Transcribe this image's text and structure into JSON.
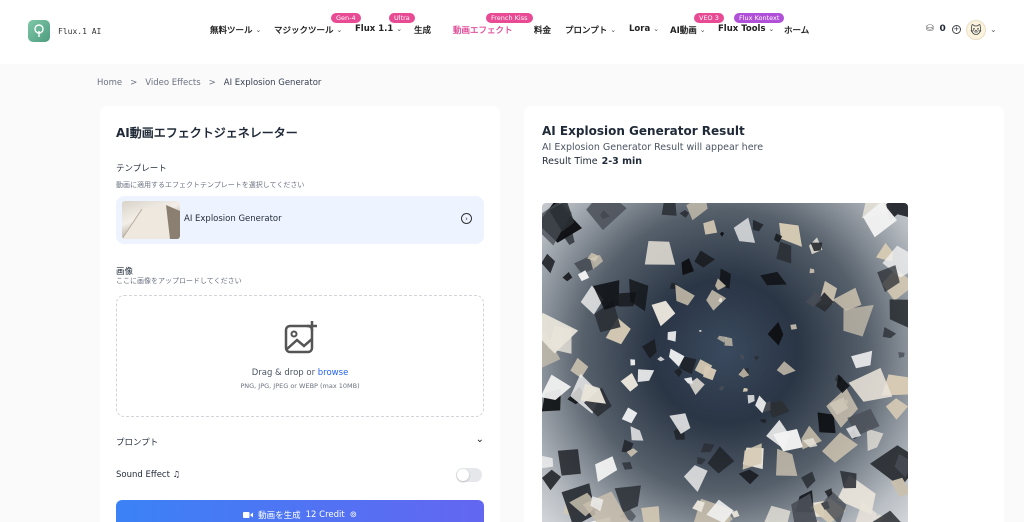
{
  "header": {
    "logo_text": "Flux.1 AI",
    "nav": [
      {
        "label": "無料ツール",
        "chev": "⌄",
        "badge": ""
      },
      {
        "label": "マジックツール",
        "chev": "⌄",
        "badge": "Gen-4"
      },
      {
        "label": "Flux 1.1",
        "chev": "⌄",
        "badge": "Ultra"
      },
      {
        "label": "生成",
        "chev": "",
        "badge": ""
      },
      {
        "label": "動画エフェクト",
        "chev": "",
        "badge": "French Kiss"
      },
      {
        "label": "料金",
        "chev": "",
        "badge": ""
      },
      {
        "label": "プロンプト",
        "chev": "⌄",
        "badge": ""
      },
      {
        "label": "Lora",
        "chev": "⌄",
        "badge": ""
      },
      {
        "label": "AI動画",
        "chev": "⌄",
        "badge": "VEO 3"
      },
      {
        "label": "Flux Tools",
        "chev": "⌄",
        "badge": "Flux Kontext"
      },
      {
        "label": "ホーム",
        "chev": "",
        "badge": ""
      }
    ],
    "credits": "0",
    "accent_pink": "#e0529c"
  },
  "breadcrumb": {
    "home": "Home",
    "section": "Video Effects",
    "current": "AI Explosion Generator",
    "sep": ">"
  },
  "left": {
    "title": "AI動画エフェクトジェネレーター",
    "template_label": "テンプレート",
    "template_hint": "動画に適用するエフェクトテンプレートを選択してください",
    "template_name": "AI Explosion Generator",
    "image_label": "画像",
    "image_hint": "ここに画像をアップロードしてください",
    "upload_text": "Drag & drop or",
    "upload_link": "browse",
    "upload_formats": "PNG, JPG, JPEG or WEBP (max 10MB)",
    "prompt_label": "プロンプト",
    "sound_label": "Sound Effect",
    "sound_enabled": false,
    "generate_label": "動画を生成",
    "generate_credit": "12 Credit"
  },
  "right": {
    "title": "AI Explosion Generator Result",
    "subtitle": "AI Explosion Generator Result will appear here",
    "time_label": "Result Time",
    "time_value": "2-3 min"
  }
}
